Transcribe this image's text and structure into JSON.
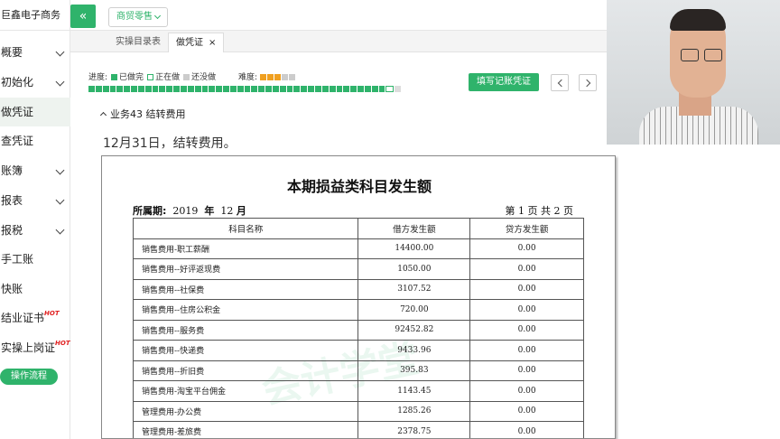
{
  "sidebar": {
    "company": "巨鑫电子商务",
    "items": [
      {
        "label": "概要",
        "has_chevron": true
      },
      {
        "label": "初始化",
        "has_chevron": true
      },
      {
        "label": "做凭证",
        "has_chevron": false
      },
      {
        "label": "查凭证",
        "has_chevron": false
      },
      {
        "label": "账簿",
        "has_chevron": true
      },
      {
        "label": "报表",
        "has_chevron": true
      },
      {
        "label": "报税",
        "has_chevron": true
      },
      {
        "label": "手工账",
        "has_chevron": false
      },
      {
        "label": "快账",
        "has_chevron": false
      },
      {
        "label": "结业证书",
        "has_chevron": false,
        "badge": "HOT"
      },
      {
        "label": "实操上岗证",
        "has_chevron": false,
        "badge": "HOT"
      }
    ],
    "flow_button": "操作流程"
  },
  "topbar": {
    "collapse_icon": "double-chevron-left-icon",
    "industry_select": "商贸零售"
  },
  "tabs": [
    {
      "label": "实操目录表",
      "active": false
    },
    {
      "label": "做凭证",
      "active": true,
      "close": "×"
    }
  ],
  "progress": {
    "label": "进度:",
    "legend_done": "已做完",
    "legend_doing": "正在做",
    "legend_todo": "还没做",
    "difficulty_label": "难度:",
    "difficulty_stars": 3,
    "difficulty_max": 5,
    "done_segments": 42,
    "total_segments": 44,
    "fill_button": "填写记账凭证"
  },
  "task": {
    "title": "业务43  结转费用",
    "description": "12月31日，结转费用。"
  },
  "document": {
    "title": "本期损益类科目发生额",
    "period_label": "所属期:",
    "year": "2019",
    "year_unit": "年",
    "month": "12",
    "month_unit": "月",
    "page_text": "第 1 页 共 2 页",
    "watermark": "会计学堂",
    "columns": [
      "科目名称",
      "借方发生额",
      "贷方发生额"
    ],
    "rows": [
      [
        "销售费用-职工薪酬",
        "14400.00",
        "0.00"
      ],
      [
        "销售费用--好评返现费",
        "1050.00",
        "0.00"
      ],
      [
        "销售费用--社保费",
        "3107.52",
        "0.00"
      ],
      [
        "销售费用--住房公积金",
        "720.00",
        "0.00"
      ],
      [
        "销售费用--服务费",
        "92452.82",
        "0.00"
      ],
      [
        "销售费用--快递费",
        "9433.96",
        "0.00"
      ],
      [
        "销售费用--折旧费",
        "395.83",
        "0.00"
      ],
      [
        "销售费用-淘宝平台佣金",
        "1143.45",
        "0.00"
      ],
      [
        "管理费用-办公费",
        "1285.26",
        "0.00"
      ],
      [
        "管理费用-差旅费",
        "2378.75",
        "0.00"
      ]
    ]
  },
  "colors": {
    "accent": "#2fb36b",
    "text": "#333333",
    "hot": "#e02020"
  }
}
